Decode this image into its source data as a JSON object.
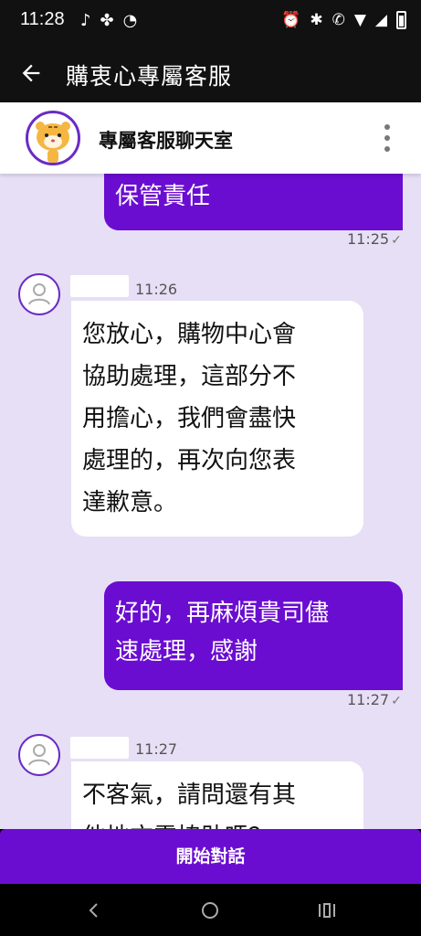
{
  "status_bar": {
    "time": "11:28"
  },
  "app_bar": {
    "title": "購衷心專屬客服"
  },
  "chat_header": {
    "title": "專屬客服聊天室"
  },
  "messages": [
    {
      "text": "保管責任",
      "time": "11:25"
    },
    {
      "time": "11:26",
      "lines": [
        "您放心，購物中心會",
        "協助處理，這部分不",
        "用擔心，我們會盡快",
        "處理的，再次向您表",
        "達歉意。"
      ]
    },
    {
      "lines": [
        "好的，再麻煩貴司儘",
        "速處理，感謝"
      ],
      "time": "11:27"
    },
    {
      "time": "11:27",
      "lines": [
        "不客氣，請問還有其",
        "他地方需協助嗎？"
      ]
    }
  ],
  "start_button": {
    "label": "開始對話"
  },
  "colors": {
    "accent": "#6a0dd1",
    "chat_bg": "#e6dff5",
    "bar_bg": "#111111"
  }
}
